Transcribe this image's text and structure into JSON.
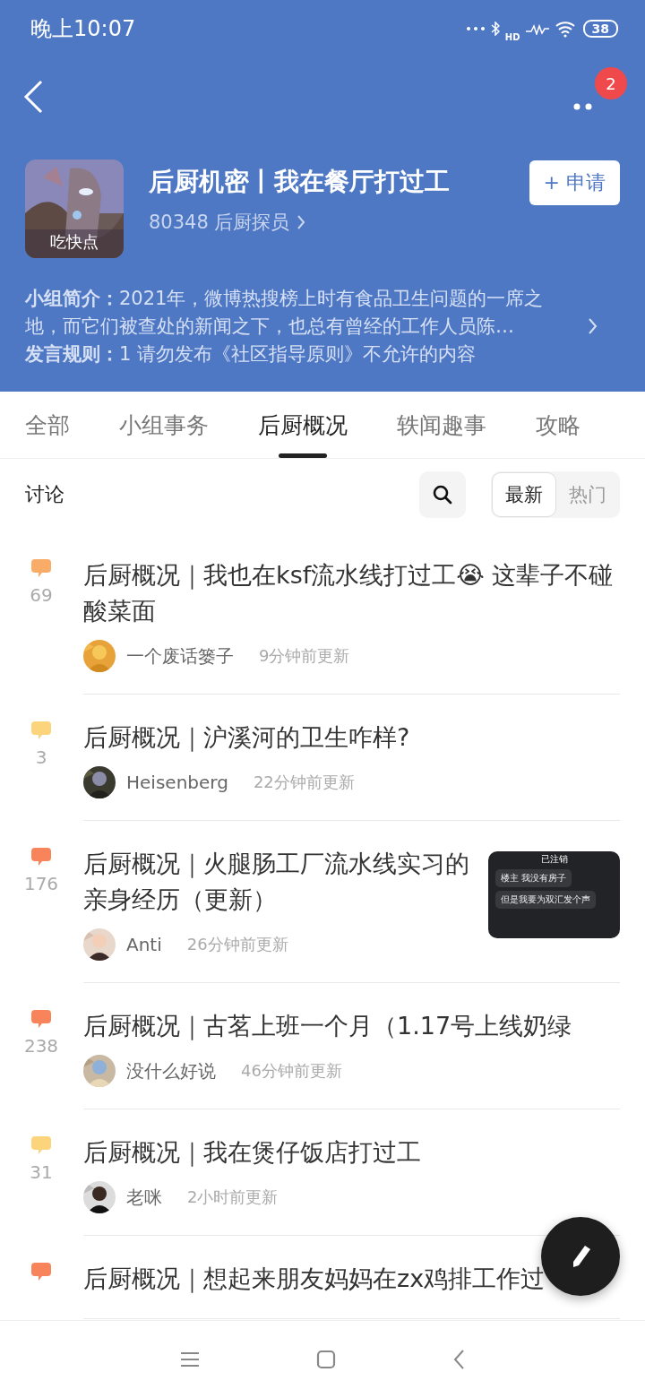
{
  "status_bar": {
    "time": "晚上10:07",
    "network": "HD",
    "battery": "38"
  },
  "nav": {
    "badge": "2"
  },
  "group": {
    "name": "后厨机密丨我在餐厅打过工",
    "caption": "吃快点",
    "members": "80348 后厨探员",
    "join_button": "+ 申请",
    "intro": "**小组简介：**2021年，微博热搜榜上时有食品卫生问题的一席之地，而它们被查处的新闻之下，也总有曾经的工作人员陈…",
    "rules": "**发言规则：**1 请勿发布《社区指导原则》不允许的内容"
  },
  "tabs": [
    {
      "label": "全部",
      "selected": false
    },
    {
      "label": "小组事务",
      "selected": false
    },
    {
      "label": "后厨概况",
      "selected": true
    },
    {
      "label": "轶闻趣事",
      "selected": false
    },
    {
      "label": "攻略",
      "selected": false
    }
  ],
  "section": {
    "title": "讨论",
    "sort": [
      {
        "label": "最新",
        "selected": true
      },
      {
        "label": "热门",
        "selected": false
      }
    ]
  },
  "posts": [
    {
      "title": "后厨概况｜我也在ksf流水线打过工😭 这辈子不碰酸菜面",
      "count": "69",
      "color": "#f9ac68",
      "author": "一个废话篓子",
      "time": "9分钟前更新"
    },
    {
      "title": "后厨概况｜沪溪河的卫生咋样?",
      "count": "3",
      "color": "#fbd47c",
      "author": "Heisenberg",
      "time": "22分钟前更新"
    },
    {
      "title": "后厨概况｜火腿肠工厂流水线实习的亲身经历（更新）",
      "count": "176",
      "color": "#f7845a",
      "author": "Anti",
      "time": "26分钟前更新",
      "image": {
        "kind": "chat",
        "header": "已注销",
        "messages": [
          "楼主 我没有房子",
          "但是我要为双汇发个声"
        ]
      }
    },
    {
      "title": "后厨概况｜古茗上班一个月（1.17号上线奶绿",
      "count": "238",
      "color": "#f7845a",
      "author": "没什么好说",
      "time": "46分钟前更新"
    },
    {
      "title": "后厨概况｜我在煲仔饭店打过工",
      "count": "31",
      "color": "#fbd47c",
      "author": "老咪",
      "time": "2小时前更新"
    },
    {
      "title": "后厨概况｜想起来朋友妈妈在zx鸡排工作过",
      "color": "#f7845a"
    }
  ]
}
